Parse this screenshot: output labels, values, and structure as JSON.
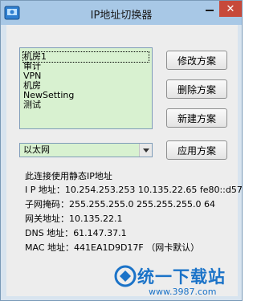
{
  "window": {
    "title": "IP地址切换器"
  },
  "profiles": {
    "items": [
      "机房1",
      "审计",
      "VPN",
      "机房",
      "NewSetting",
      "测试"
    ],
    "selected_index": 0
  },
  "buttons": {
    "modify": "修改方案",
    "delete": "删除方案",
    "new": "新建方案",
    "apply": "应用方案"
  },
  "adapter": {
    "selected": "以太网"
  },
  "info": {
    "status": "此连接使用静态IP地址",
    "ip_label": "I P 地址：",
    "ip_value": "10.254.253.253  10.135.22.65  fe80::d57",
    "mask_label": "子网掩码：",
    "mask_value": "255.255.255.0  255.255.255.0  64",
    "gateway_label": "网关地址：",
    "gateway_value": "10.135.22.1",
    "dns_label": "DNS 地址：",
    "dns_value": "61.147.37.1",
    "mac_label": "MAC 地址：",
    "mac_value": "441EA1D9D17F （网卡默认）"
  },
  "watermark": {
    "brand": "统一下载站",
    "url": "www.3987.com"
  },
  "colors": {
    "title_bar": "#a8c8e6",
    "close_button": "#c7493a",
    "list_background": "#d8f1d0",
    "watermark": "#1b73c8"
  }
}
